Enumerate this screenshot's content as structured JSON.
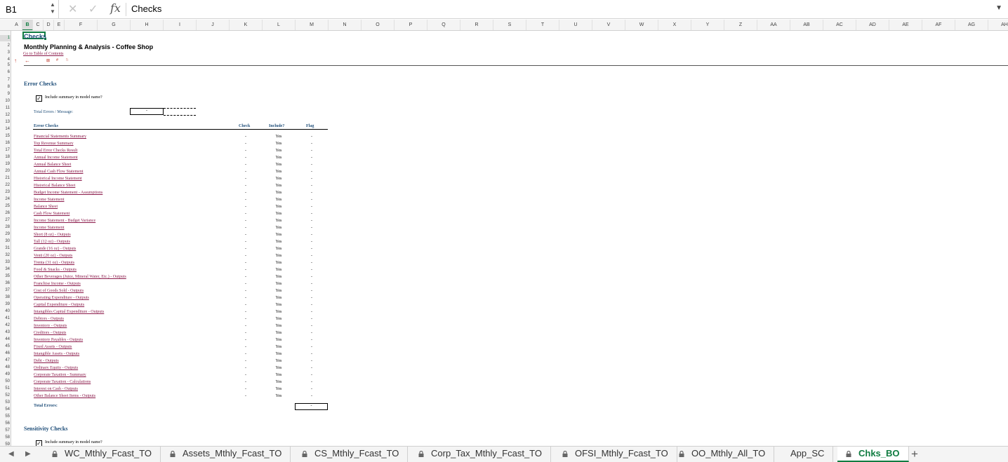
{
  "formula_bar": {
    "name_box": "B1",
    "cancel_icon": "close-icon",
    "enter_icon": "check-icon",
    "fx_label": "fx",
    "formula": "Checks"
  },
  "columns": [
    "A",
    "B",
    "C",
    "D",
    "E",
    "F",
    "G",
    "H",
    "I",
    "J",
    "K",
    "L",
    "M",
    "N",
    "O",
    "P",
    "Q",
    "R",
    "S",
    "T",
    "U",
    "V",
    "W",
    "X",
    "Y",
    "Z",
    "AA",
    "AB",
    "AC",
    "AD",
    "AE",
    "AF",
    "AG",
    "AH"
  ],
  "selected_column": "B",
  "rows": [
    1,
    2,
    3,
    4,
    5,
    6,
    7,
    8,
    9,
    10,
    11,
    12,
    13,
    14,
    15,
    16,
    17,
    18,
    19,
    20,
    21,
    22,
    23,
    24,
    25,
    26,
    27,
    28,
    29,
    30,
    31,
    32,
    33,
    34,
    35,
    36,
    37,
    38,
    39,
    40,
    41,
    42,
    43,
    44,
    45,
    46,
    47,
    48,
    49,
    50,
    51,
    52,
    53,
    54,
    55,
    56,
    57,
    58,
    59
  ],
  "selected_row": 1,
  "sheet": {
    "title": "Checks",
    "subtitle": "Monthly Planning & Analysis - Coffee Shop",
    "toc_link": "Go to Table of Contents",
    "nav_symbols": [
      "↑",
      "←",
      "⊠",
      "#",
      "!:"
    ],
    "error_section": {
      "heading": "Error Checks",
      "include_summary_label": "Include summary in model name?",
      "include_summary_checked": "✓",
      "total_label": "Total Errors / Message:",
      "total_value": "-",
      "table_headers": {
        "name": "Error Checks",
        "check": "Check",
        "include": "Include?",
        "flag": "Flag"
      },
      "items": [
        {
          "name": "Financial Statements Summary",
          "check": "-",
          "include": "Yes",
          "flag": "-"
        },
        {
          "name": "Top Revenue Summary",
          "check": "-",
          "include": "Yes",
          "flag": "-"
        },
        {
          "name": "Total Error Checks Result",
          "check": "-",
          "include": "Yes",
          "flag": "-"
        },
        {
          "name": "Annual Income Statement",
          "check": "-",
          "include": "Yes",
          "flag": "-"
        },
        {
          "name": "Annual Balance Sheet",
          "check": "-",
          "include": "Yes",
          "flag": "-"
        },
        {
          "name": "Annual Cash Flow Statement",
          "check": "-",
          "include": "Yes",
          "flag": "-"
        },
        {
          "name": "Historical Income Statement",
          "check": "-",
          "include": "Yes",
          "flag": "-"
        },
        {
          "name": "Historical Balance Sheet",
          "check": "-",
          "include": "Yes",
          "flag": "-"
        },
        {
          "name": "Budget Income Statement - Assumptions",
          "check": "-",
          "include": "Yes",
          "flag": "-"
        },
        {
          "name": "Income Statement",
          "check": "-",
          "include": "Yes",
          "flag": "-"
        },
        {
          "name": "Balance Sheet",
          "check": "-",
          "include": "Yes",
          "flag": "-"
        },
        {
          "name": "Cash Flow Statement",
          "check": "-",
          "include": "Yes",
          "flag": "-"
        },
        {
          "name": "Income Statement - Budget Variance",
          "check": "-",
          "include": "Yes",
          "flag": "-"
        },
        {
          "name": "Income Statement",
          "check": "-",
          "include": "Yes",
          "flag": "-"
        },
        {
          "name": "Short (8 oz) - Outputs",
          "check": "-",
          "include": "Yes",
          "flag": "-"
        },
        {
          "name": "Tall (12 oz) - Outputs",
          "check": "-",
          "include": "Yes",
          "flag": "-"
        },
        {
          "name": "Grande (16 oz) - Outputs",
          "check": "-",
          "include": "Yes",
          "flag": "-"
        },
        {
          "name": "Venti (20 oz) - Outputs",
          "check": "-",
          "include": "Yes",
          "flag": "-"
        },
        {
          "name": "Trenta (31 oz) - Outputs",
          "check": "-",
          "include": "Yes",
          "flag": "-"
        },
        {
          "name": "Food & Snacks - Outputs",
          "check": "-",
          "include": "Yes",
          "flag": "-"
        },
        {
          "name": "Other Beverages (Juice, Mineral Water, Etc.) - Outputs",
          "check": "-",
          "include": "Yes",
          "flag": "-"
        },
        {
          "name": "Franchise Income - Outputs",
          "check": "-",
          "include": "Yes",
          "flag": "-"
        },
        {
          "name": "Cost of Goods Sold - Outputs",
          "check": "-",
          "include": "Yes",
          "flag": "-"
        },
        {
          "name": "Operating Expenditure - Outputs",
          "check": "-",
          "include": "Yes",
          "flag": "-"
        },
        {
          "name": "Capital Expenditure - Outputs",
          "check": "-",
          "include": "Yes",
          "flag": "-"
        },
        {
          "name": "Intangibles Capital Expenditure - Outputs",
          "check": "-",
          "include": "Yes",
          "flag": "-"
        },
        {
          "name": "Debtors - Outputs",
          "check": "-",
          "include": "Yes",
          "flag": "-"
        },
        {
          "name": "Inventory - Outputs",
          "check": "-",
          "include": "Yes",
          "flag": "-"
        },
        {
          "name": "Creditors - Outputs",
          "check": "-",
          "include": "Yes",
          "flag": "-"
        },
        {
          "name": "Inventory Payables - Outputs",
          "check": "-",
          "include": "Yes",
          "flag": "-"
        },
        {
          "name": "Fixed Assets - Outputs",
          "check": "-",
          "include": "Yes",
          "flag": "-"
        },
        {
          "name": "Intangible Assets - Outputs",
          "check": "-",
          "include": "Yes",
          "flag": "-"
        },
        {
          "name": "Debt - Outputs",
          "check": "-",
          "include": "Yes",
          "flag": "-"
        },
        {
          "name": "Ordinary Equity - Outputs",
          "check": "-",
          "include": "Yes",
          "flag": "-"
        },
        {
          "name": "Corporate Taxation - Summary",
          "check": "-",
          "include": "Yes",
          "flag": "-"
        },
        {
          "name": "Corporate Taxation - Calculations",
          "check": "-",
          "include": "Yes",
          "flag": "-"
        },
        {
          "name": "Interest on Cash - Outputs",
          "check": "-",
          "include": "Yes",
          "flag": "-"
        },
        {
          "name": "Other Balance Sheet Items - Outputs",
          "check": "-",
          "include": "Yes",
          "flag": "-"
        }
      ],
      "total_errors_label": "Total Errors:",
      "total_errors_value": "-"
    },
    "sensitivity_section": {
      "heading": "Sensitivity Checks",
      "include_summary_label": "Include summary in model name?",
      "include_summary_checked": "✓"
    }
  },
  "tabs": [
    {
      "label": "WC_Mthly_Fcast_TO",
      "locked": true,
      "active": false
    },
    {
      "label": "Assets_Mthly_Fcast_TO",
      "locked": true,
      "active": false
    },
    {
      "label": "CS_Mthly_Fcast_TO",
      "locked": true,
      "active": false
    },
    {
      "label": "Corp_Tax_Mthly_Fcast_TO",
      "locked": true,
      "active": false
    },
    {
      "label": "OFSI_Mthly_Fcast_TO",
      "locked": true,
      "active": false
    },
    {
      "label": "OO_Mthly_All_TO",
      "locked": true,
      "active": false
    },
    {
      "label": "App_SC",
      "locked": false,
      "active": false
    },
    {
      "label": "Chks_BO",
      "locked": true,
      "active": true
    }
  ],
  "tab_nav": {
    "prev": "◀",
    "next": "▶"
  },
  "add_sheet": "+",
  "colors": {
    "accent": "#107c41",
    "heading_blue": "#1f4e79",
    "link_maroon": "#8b1a4a",
    "nav_red": "#c0392b"
  }
}
